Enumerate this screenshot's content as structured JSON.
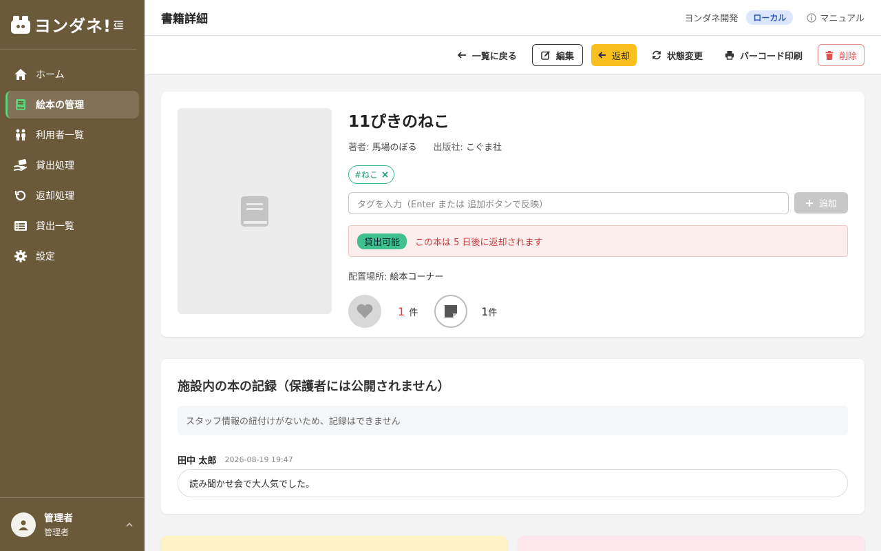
{
  "app": {
    "logo_text": "ヨンダネ!"
  },
  "sidebar": {
    "items": [
      {
        "label": "ホーム",
        "icon": "home-icon",
        "active": false
      },
      {
        "label": "絵本の管理",
        "icon": "book-icon",
        "active": true
      },
      {
        "label": "利用者一覧",
        "icon": "users-icon",
        "active": false
      },
      {
        "label": "貸出処理",
        "icon": "hand-lend-icon",
        "active": false
      },
      {
        "label": "返却処理",
        "icon": "return-icon",
        "active": false
      },
      {
        "label": "貸出一覧",
        "icon": "list-icon",
        "active": false
      },
      {
        "label": "設定",
        "icon": "gear-icon",
        "active": false
      }
    ],
    "user": {
      "name": "管理者",
      "role": "管理者"
    }
  },
  "header": {
    "title": "書籍詳細",
    "org": "ヨンダネ開発",
    "env_badge": "ローカル",
    "manual": "マニュアル"
  },
  "toolbar": {
    "back": "一覧に戻る",
    "edit": "編集",
    "return": "返却",
    "status_change": "状態変更",
    "barcode": "バーコード印刷",
    "delete": "削除"
  },
  "book": {
    "title": "11ぴきのねこ",
    "author_label": "著者:",
    "author": "馬場のぼる",
    "publisher_label": "出版社:",
    "publisher": "こぐま社",
    "tags": [
      "#ねこ"
    ],
    "tag_placeholder": "タグを入力（Enter または 追加ボタンで反映）",
    "add_button": "追加",
    "status": "貸出可能",
    "status_message": "この本は 5 日後に返却されます",
    "location_label": "配置場所:",
    "location": "絵本コーナー",
    "favorites_count": "1",
    "favorites_unit": "件",
    "notes_count": "1",
    "notes_unit": "件"
  },
  "records": {
    "title": "施設内の本の記録（保護者には公開されません）",
    "notice": "スタッフ情報の紐付けがないため、記録はできません",
    "entries": [
      {
        "author": "田中 太郎",
        "time": "2026-08-19 19:47",
        "text": "読み聞かせ会で大人気でした。"
      }
    ]
  },
  "colors": {
    "sidebar_bg": "#6b5a3a",
    "accent_green": "#5fd07a",
    "return_yellow": "#f9bf1e",
    "danger": "#e05252",
    "status_green": "#3fc08e"
  }
}
